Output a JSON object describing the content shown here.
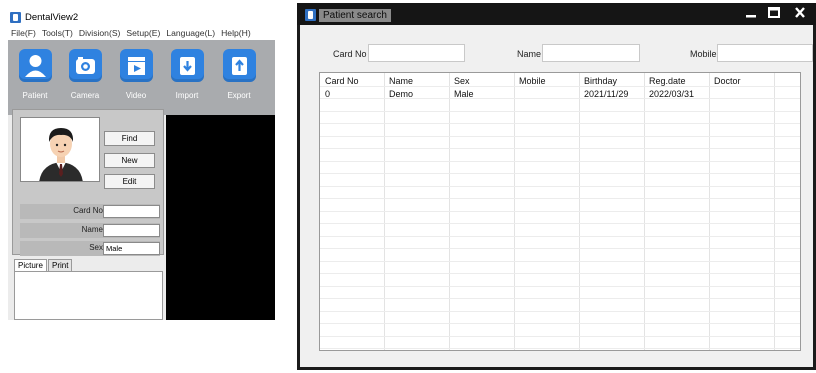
{
  "left_window": {
    "title": "DentalView2",
    "menu": [
      "File(F)",
      "Tools(T)",
      "Division(S)",
      "Setup(E)",
      "Language(L)",
      "Help(H)"
    ],
    "toolbar": [
      {
        "label": "Patient",
        "icon": "person-icon"
      },
      {
        "label": "Camera",
        "icon": "camera-icon"
      },
      {
        "label": "Video",
        "icon": "video-icon"
      },
      {
        "label": "Import",
        "icon": "import-icon"
      },
      {
        "label": "Export",
        "icon": "export-icon"
      }
    ],
    "buttons": {
      "find": "Find",
      "new": "New",
      "edit": "Edit"
    },
    "fields": {
      "card_no": {
        "label": "Card No",
        "value": ""
      },
      "name": {
        "label": "Name",
        "value": ""
      },
      "sex": {
        "label": "Sex",
        "value": "Male"
      }
    },
    "tabs": [
      "Picture",
      "Print"
    ]
  },
  "right_window": {
    "title": "Patient search",
    "search": {
      "card_no_label": "Card No",
      "name_label": "Name",
      "mobile_label": "Mobile",
      "card_no_value": "",
      "name_value": "",
      "mobile_value": ""
    },
    "table": {
      "columns": [
        "Card No",
        "Name",
        "Sex",
        "Mobile",
        "Birthday",
        "Reg.date",
        "Doctor"
      ],
      "rows": [
        [
          "0",
          "Demo",
          "Male",
          "",
          "2021/11/29",
          "2022/03/31",
          ""
        ]
      ]
    }
  },
  "colors": {
    "toolbar_bg": "#a9abae",
    "icon_blue": "#2f82e0",
    "dark_frame": "#1b1b1b"
  }
}
